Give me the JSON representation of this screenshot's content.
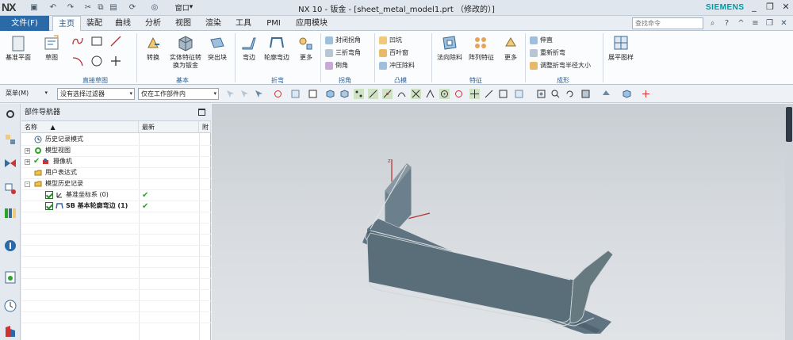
{
  "app": {
    "logo": "NX",
    "window_title": "NX 10 - 钣金 - [sheet_metal_model1.prt （修改的）]",
    "brand": "SIEMENS",
    "quick_access": {
      "window_label": "窗口"
    }
  },
  "menu": {
    "file": "文件(F)",
    "tabs": [
      "主页",
      "装配",
      "曲线",
      "分析",
      "视图",
      "渲染",
      "工具",
      "PMI",
      "应用模块"
    ],
    "active_tab": "主页",
    "search_placeholder": "查找命令"
  },
  "ribbon": {
    "groups": [
      {
        "label": "直接草图",
        "buttons": [
          "基准平面",
          "草图"
        ]
      },
      {
        "label": "基本",
        "buttons": [
          "转换",
          "实体特征转换为钣金",
          "突出块"
        ]
      },
      {
        "label": "折弯",
        "buttons": [
          "弯边",
          "轮廓弯边",
          "更多"
        ]
      },
      {
        "label": "拐角",
        "items": [
          "封闭拐角",
          "三折弯角",
          "倒角"
        ]
      },
      {
        "label": "凸模",
        "items": [
          "凹坑",
          "百叶窗",
          "冲压除料"
        ]
      },
      {
        "label": "特征",
        "buttons": [
          "法向除料",
          "阵列特征",
          "更多"
        ]
      },
      {
        "label": "成形",
        "items": [
          "伸直",
          "重新折弯",
          "调整折弯半径大小"
        ]
      },
      {
        "label": "",
        "buttons": [
          "展平图样"
        ]
      }
    ]
  },
  "toolbar": {
    "menu_label": "菜单(M)",
    "filter_value": "没有选择过滤器",
    "scope_value": "仅在工作部件内"
  },
  "navigator": {
    "title": "部件导航器",
    "columns": [
      "名称",
      "最新",
      "附"
    ],
    "rows": [
      {
        "label": "历史记录模式",
        "level": 1,
        "icon": "clock-icon"
      },
      {
        "label": "模型视图",
        "level": 1,
        "icon": "model-views-icon",
        "expandable": true
      },
      {
        "label": "摄像机",
        "level": 1,
        "icon": "camera-icon",
        "expandable": true,
        "checked": true
      },
      {
        "label": "用户表达式",
        "level": 1,
        "icon": "folder-icon"
      },
      {
        "label": "模型历史记录",
        "level": 1,
        "icon": "folder-icon",
        "expanded": true
      },
      {
        "label": "基准坐标系 (0)",
        "level": 2,
        "icon": "datum-csys-icon",
        "checked": true,
        "latest": true
      },
      {
        "label": "SB 基本轮廓弯边 (1)",
        "level": 2,
        "icon": "contour-flange-icon",
        "checked": true,
        "latest": true,
        "bold": true
      }
    ]
  },
  "colors": {
    "file_tab": "#2a6aa8",
    "part_face": "#5f7480",
    "part_edge": "#cfd6db",
    "brand": "#00969e"
  }
}
